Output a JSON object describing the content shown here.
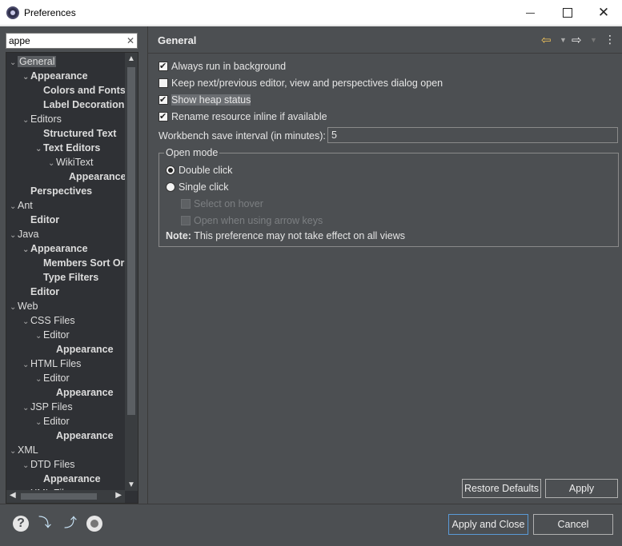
{
  "window": {
    "title": "Preferences",
    "icons": [
      "app-icon",
      "minimize-icon",
      "maximize-icon",
      "close-icon"
    ]
  },
  "filter": {
    "value": "appe",
    "clear_glyph": "✕"
  },
  "tree": {
    "items": [
      {
        "label": "General",
        "level": 0,
        "expanded": true,
        "bold": false,
        "selected": true
      },
      {
        "label": "Appearance",
        "level": 1,
        "expanded": true,
        "bold": true
      },
      {
        "label": "Colors and Fonts",
        "level": 2,
        "bold": true
      },
      {
        "label": "Label Decorations",
        "level": 2,
        "bold": true
      },
      {
        "label": "Editors",
        "level": 1,
        "expanded": true,
        "bold": false
      },
      {
        "label": "Structured Text",
        "level": 2,
        "bold": true
      },
      {
        "label": "Text Editors",
        "level": 2,
        "expanded": true,
        "bold": true
      },
      {
        "label": "WikiText",
        "level": 3,
        "expanded": true,
        "bold": false
      },
      {
        "label": "Appearance",
        "level": 4,
        "bold": true
      },
      {
        "label": "Perspectives",
        "level": 1,
        "bold": true
      },
      {
        "label": "Ant",
        "level": 0,
        "expanded": true,
        "bold": false
      },
      {
        "label": "Editor",
        "level": 1,
        "bold": true
      },
      {
        "label": "Java",
        "level": 0,
        "expanded": true,
        "bold": false
      },
      {
        "label": "Appearance",
        "level": 1,
        "expanded": true,
        "bold": true
      },
      {
        "label": "Members Sort Order",
        "level": 2,
        "bold": true
      },
      {
        "label": "Type Filters",
        "level": 2,
        "bold": true
      },
      {
        "label": "Editor",
        "level": 1,
        "bold": true
      },
      {
        "label": "Web",
        "level": 0,
        "expanded": true,
        "bold": false
      },
      {
        "label": "CSS Files",
        "level": 1,
        "expanded": true,
        "bold": false
      },
      {
        "label": "Editor",
        "level": 2,
        "expanded": true,
        "bold": false
      },
      {
        "label": "Appearance",
        "level": 3,
        "bold": true
      },
      {
        "label": "HTML Files",
        "level": 1,
        "expanded": true,
        "bold": false
      },
      {
        "label": "Editor",
        "level": 2,
        "expanded": true,
        "bold": false
      },
      {
        "label": "Appearance",
        "level": 3,
        "bold": true
      },
      {
        "label": "JSP Files",
        "level": 1,
        "expanded": true,
        "bold": false
      },
      {
        "label": "Editor",
        "level": 2,
        "expanded": true,
        "bold": false
      },
      {
        "label": "Appearance",
        "level": 3,
        "bold": true
      },
      {
        "label": "XML",
        "level": 0,
        "expanded": true,
        "bold": false
      },
      {
        "label": "DTD Files",
        "level": 1,
        "expanded": true,
        "bold": false
      },
      {
        "label": "Appearance",
        "level": 2,
        "bold": true
      },
      {
        "label": "XML Files",
        "level": 1,
        "expanded": true,
        "bold": false
      }
    ]
  },
  "panel": {
    "title": "General",
    "nav_icons": [
      "back-arrow-icon",
      "back-dropdown-icon",
      "forward-arrow-icon",
      "forward-dropdown-icon",
      "view-menu-icon"
    ],
    "options": [
      {
        "label": "Always run in background",
        "checked": true
      },
      {
        "label": "Keep next/previous editor, view and perspectives dialog open",
        "checked": false
      },
      {
        "label": "Show heap status",
        "checked": true
      },
      {
        "label": "Rename resource inline if available",
        "checked": true
      }
    ],
    "interval_label": "Workbench save interval (in minutes):",
    "interval_value": "5",
    "open_mode": {
      "title": "Open mode",
      "double_click": "Double click",
      "single_click": "Single click",
      "select_on_hover": "Select on hover",
      "open_arrow_keys": "Open when using arrow keys",
      "selected": "double_click",
      "note_prefix": "Note:",
      "note_text": " This preference may not take effect on all views"
    },
    "restore_defaults": "Restore Defaults",
    "apply": "Apply"
  },
  "bottom": {
    "icons": [
      "help-icon",
      "import-icon",
      "export-icon",
      "record-icon"
    ],
    "apply_and_close": "Apply and Close",
    "cancel": "Cancel"
  }
}
